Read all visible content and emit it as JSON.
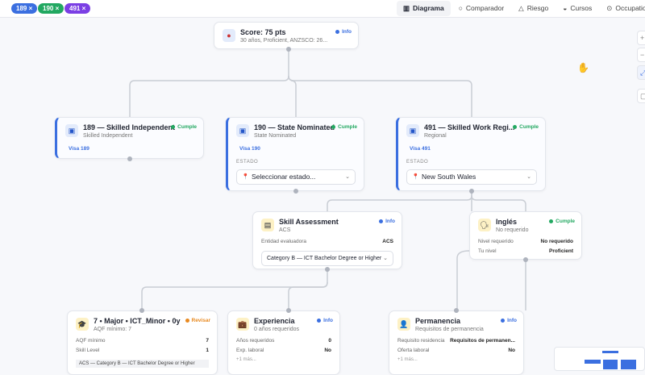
{
  "filters": [
    {
      "label": "189",
      "color": "#3b6fe0"
    },
    {
      "label": "190",
      "color": "#22a861"
    },
    {
      "label": "491",
      "color": "#7b3fe4"
    }
  ],
  "tabs": [
    {
      "label": "Diagrama",
      "icon": "chart-icon"
    },
    {
      "label": "Comparador",
      "icon": "search-icon"
    },
    {
      "label": "Riesgo",
      "icon": "warning-icon"
    },
    {
      "label": "Cursos",
      "icon": "graduation-icon"
    },
    {
      "label": "Occupation",
      "icon": "location-pin-icon"
    }
  ],
  "colors": {
    "cumple": "#22a861",
    "info": "#3b6fe0",
    "revisar": "#e8891f"
  },
  "score": {
    "title": "Score: 75 pts",
    "sub": "30 años, Proficient, ANZSCO: 26...",
    "badge": "Info"
  },
  "visa189": {
    "title": "189 — Skilled Independent",
    "sub": "Skilled Independent",
    "badge": "Cumple",
    "link": "Visa 189"
  },
  "visa190": {
    "title": "190 — State Nominated",
    "sub": "State Nominated",
    "badge": "Cumple",
    "link": "Visa 190",
    "estado_label": "ESTADO",
    "select": "Seleccionar estado..."
  },
  "visa491": {
    "title": "491 — Skilled Work Regi...",
    "sub": "Regional",
    "badge": "Cumple",
    "link": "Visa 491",
    "estado_label": "ESTADO",
    "select": "New South Wales"
  },
  "skill": {
    "title": "Skill Assessment",
    "sub": "ACS",
    "badge": "Info",
    "row_label": "Entidad evaluadora",
    "row_value": "ACS",
    "select": "Category B — ICT Bachelor Degree or Higher"
  },
  "ingles": {
    "title": "Inglés",
    "sub": "No requerido",
    "badge": "Cumple",
    "rows": [
      {
        "k": "Nivel requerido",
        "v": "No requerido"
      },
      {
        "k": "Tu nivel",
        "v": "Proficient"
      }
    ]
  },
  "aqf": {
    "title": "7 • Major • ICT_Minor • 0y",
    "sub": "AQF mínimo: 7",
    "badge": "Revisar",
    "rows": [
      {
        "k": "AQF mínimo",
        "v": "7"
      },
      {
        "k": "Skill Level",
        "v": "1"
      }
    ],
    "note": "ACS — Category B — ICT Bachelor Degree or Higher"
  },
  "exp": {
    "title": "Experiencia",
    "sub": "0 años requeridos",
    "badge": "Info",
    "rows": [
      {
        "k": "Años requeridos",
        "v": "0"
      },
      {
        "k": "Exp. laboral",
        "v": "No"
      }
    ],
    "more": "+1 más..."
  },
  "perm": {
    "title": "Permanencia",
    "sub": "Requisitos de permanencia",
    "badge": "Info",
    "rows": [
      {
        "k": "Requisito residencia",
        "v": "Requisitos de permanen..."
      },
      {
        "k": "Oferta laboral",
        "v": "No"
      }
    ],
    "more": "+1 más..."
  },
  "controls": [
    "+",
    "−",
    "⤢",
    "▢"
  ]
}
